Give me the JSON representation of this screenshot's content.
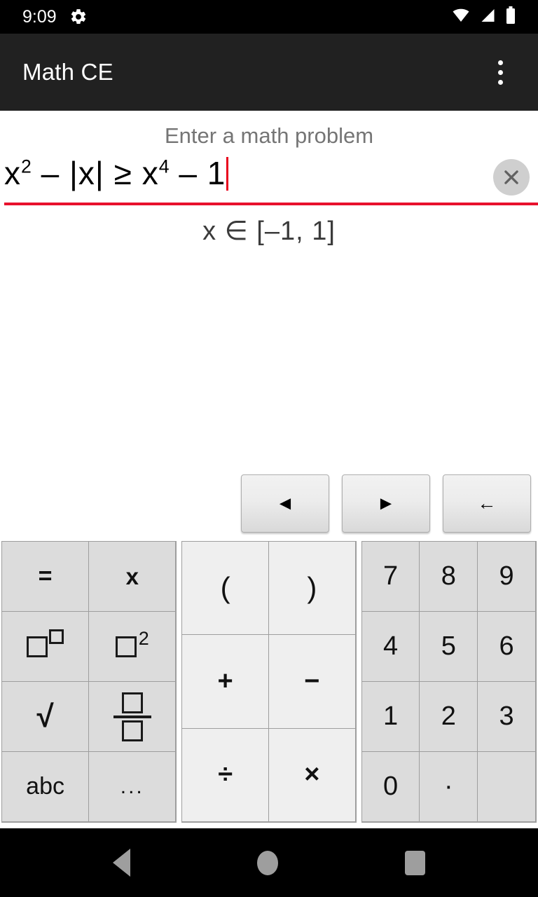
{
  "status_bar": {
    "time": "9:09",
    "icons": [
      "gear-icon",
      "wifi-icon",
      "cellular-signal-icon",
      "battery-icon"
    ]
  },
  "app_bar": {
    "title": "Math CE",
    "overflow_label": "more-options"
  },
  "editor": {
    "hint": "Enter a math problem",
    "expression_parts": {
      "p1": "x",
      "sup1": "2",
      "p2": " – |x| ≥ ",
      "p3": "x",
      "sup2": "4",
      "p4": " – 1"
    },
    "expression_plain": "x² – |x| ≥ x⁴ – 1",
    "answer": "x ∈ [–1, 1]",
    "clear_label": "✕",
    "underline_color": "#e8112d",
    "cursor_color": "#e8001c"
  },
  "cursor_bar": {
    "buttons": [
      {
        "name": "move-left",
        "label": "◄"
      },
      {
        "name": "move-right",
        "label": "►"
      },
      {
        "name": "backspace",
        "label": "←"
      }
    ]
  },
  "keypads": {
    "symbols": [
      {
        "name": "equals",
        "label": "="
      },
      {
        "name": "variable-x",
        "label": "x"
      },
      {
        "name": "power-box",
        "label": "□^□"
      },
      {
        "name": "square-box",
        "label": "□²"
      },
      {
        "name": "square-root",
        "label": "√"
      },
      {
        "name": "fraction",
        "label": "□/□"
      },
      {
        "name": "alphabet",
        "label": "abc"
      },
      {
        "name": "more-symbols",
        "label": "..."
      }
    ],
    "operators": [
      {
        "name": "open-paren",
        "label": "("
      },
      {
        "name": "close-paren",
        "label": ")"
      },
      {
        "name": "plus",
        "label": "+"
      },
      {
        "name": "minus",
        "label": "−"
      },
      {
        "name": "divide",
        "label": "÷"
      },
      {
        "name": "multiply",
        "label": "×"
      }
    ],
    "numbers": [
      {
        "name": "seven",
        "label": "7"
      },
      {
        "name": "eight",
        "label": "8"
      },
      {
        "name": "nine",
        "label": "9"
      },
      {
        "name": "four",
        "label": "4"
      },
      {
        "name": "five",
        "label": "5"
      },
      {
        "name": "six",
        "label": "6"
      },
      {
        "name": "one",
        "label": "1"
      },
      {
        "name": "two",
        "label": "2"
      },
      {
        "name": "three",
        "label": "3"
      },
      {
        "name": "zero",
        "label": "0"
      },
      {
        "name": "decimal-point",
        "label": "·"
      },
      {
        "name": "empty",
        "label": ""
      }
    ]
  },
  "system_nav": {
    "back": "back",
    "home": "home",
    "recents": "recents"
  },
  "colors": {
    "status_bar_bg": "#000000",
    "app_bar_bg": "#212121",
    "key_bg_side": "#dcdcdc",
    "key_bg_mid": "#efefef",
    "accent_red": "#e8112d"
  }
}
